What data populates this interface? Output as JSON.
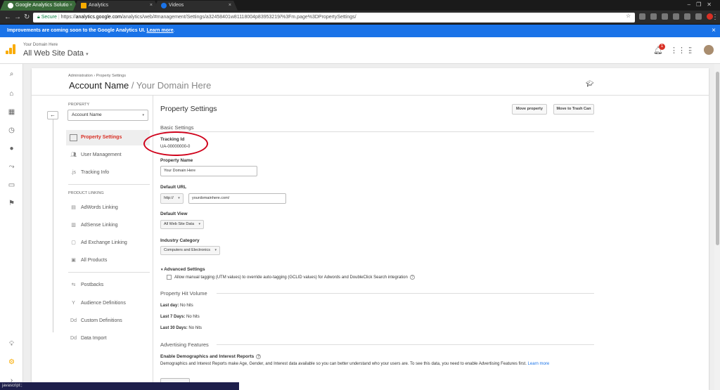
{
  "browser": {
    "tabs": [
      {
        "label": "Google Analytics Solutio",
        "favicon_color": "#ffffff"
      },
      {
        "label": "Analytics",
        "favicon_color": "#f9ab00"
      },
      {
        "label": "Videos",
        "favicon_color": "#1a73e8"
      }
    ],
    "url": {
      "secure_label": "Secure",
      "scheme": "https://",
      "host": "analytics.google.com",
      "path": "/analytics/web/#management/Settings/a32458401w81118004p83953219/%3Fm.page%3DPropertySettings/"
    },
    "status_text": "javascript:;"
  },
  "banner": {
    "text": "Improvements are coming soon to the Google Analytics UI.",
    "link": "Learn more",
    "suffix": "."
  },
  "header": {
    "account_small": "Your Domain Here",
    "view_name": "All Web Site Data",
    "notification_count": "1"
  },
  "breadcrumb": {
    "items": [
      "Administration",
      "Property Settings"
    ],
    "separator": "›"
  },
  "title": {
    "account": "Account Name",
    "separator": " / ",
    "property": "Your Domain Here"
  },
  "sidebar": {
    "property_label": "PROPERTY",
    "property_select": "Account Name",
    "items": [
      {
        "label": "Property Settings",
        "icon": "settings-page-icon"
      },
      {
        "label": "User Management",
        "icon": "users-icon"
      },
      {
        "label": "Tracking Info",
        "icon": "js-icon"
      }
    ],
    "product_linking_label": "PRODUCT LINKING",
    "linking_items": [
      {
        "label": "AdWords Linking",
        "icon": "adwords-icon"
      },
      {
        "label": "AdSense Linking",
        "icon": "adsense-icon"
      },
      {
        "label": "Ad Exchange Linking",
        "icon": "ad-exchange-icon"
      },
      {
        "label": "All Products",
        "icon": "all-products-icon"
      }
    ],
    "other_items": [
      {
        "label": "Postbacks",
        "icon": "postbacks-icon"
      },
      {
        "label": "Audience Definitions",
        "icon": "audience-icon"
      },
      {
        "label": "Custom Definitions",
        "icon": "dd-icon"
      },
      {
        "label": "Data Import",
        "icon": "dd-icon"
      }
    ]
  },
  "content": {
    "heading": "Property Settings",
    "move_property": "Move property",
    "move_trash": "Move to Trash Can",
    "basic_settings": "Basic Settings",
    "tracking_id_label": "Tracking Id",
    "tracking_id_value": "UA-00000000-0",
    "property_name_label": "Property Name",
    "property_name_value": "Your Domain Here",
    "default_url_label": "Default URL",
    "url_scheme": "http://",
    "url_value": "yourdomainhere.com/",
    "default_view_label": "Default View",
    "default_view_value": "All Web Site Data",
    "industry_label": "Industry Category",
    "industry_value": "Computers and Electronics",
    "advanced_label": "Advanced Settings",
    "advanced_checkbox": "Allow manual tagging (UTM values) to override auto-tagging (GCLID values) for Adwords and DoubleClick Search integration",
    "hit_volume": "Property Hit Volume",
    "last_day_label": "Last day:",
    "last_day_value": "No hits",
    "last7_label": "Last 7 Days:",
    "last7_value": "No hits",
    "last30_label": "Last 30 Days:",
    "last30_value": "No hits",
    "advertising_features": "Advertising Features",
    "demographics_label": "Enable Demographics and Interest Reports",
    "demographics_desc": "Demographics and Interest Reports make Age, Gender, and Interest data available so you can better understand who your users are. To see this data, you need to enable Advertising Features first.",
    "demographics_link": "Learn more"
  },
  "colors": {
    "accent_red": "#d93025",
    "banner_blue": "#1a73e8",
    "logo_orange": "#f9ab00",
    "annotation_red": "#d0021b"
  }
}
